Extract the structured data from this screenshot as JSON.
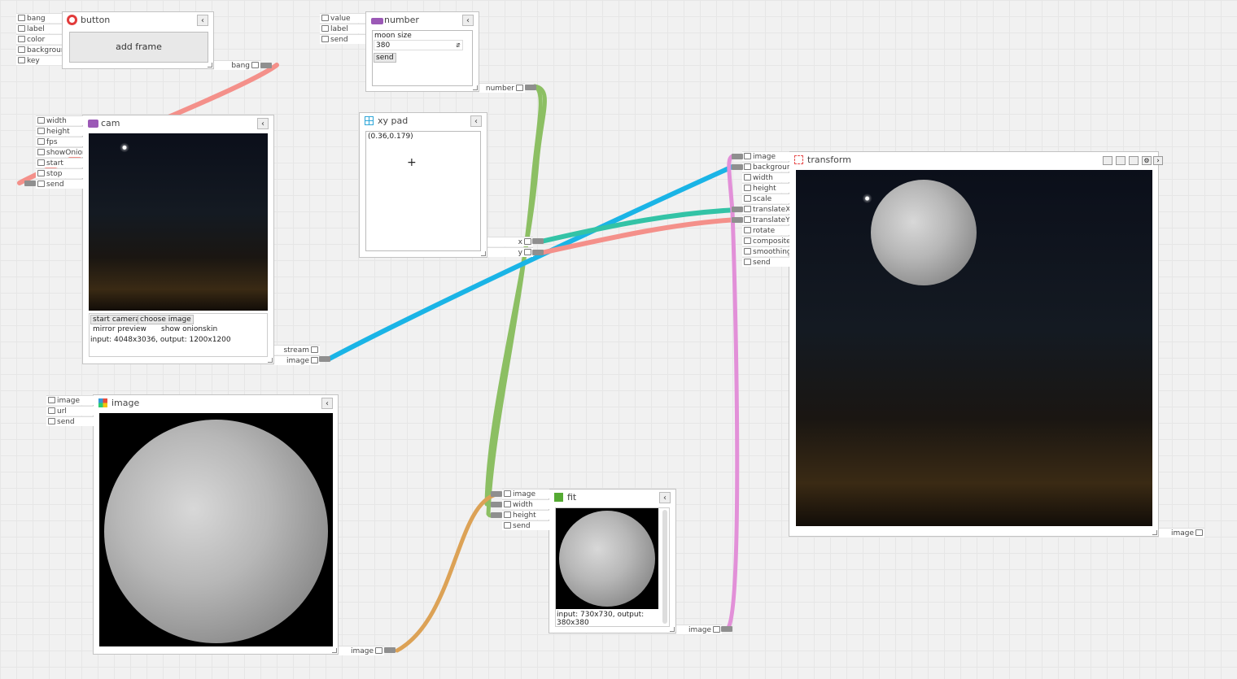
{
  "nodes": {
    "button": {
      "title": "button",
      "inputs": [
        "bang",
        "label",
        "color",
        "background",
        "key"
      ],
      "button_label": "add frame",
      "outputs": [
        "bang"
      ]
    },
    "number": {
      "title": "number",
      "inputs": [
        "value",
        "label",
        "send"
      ],
      "label": "moon size",
      "value": "380",
      "send_label": "send",
      "outputs": [
        "number"
      ]
    },
    "cam": {
      "title": "cam",
      "inputs": [
        "width",
        "height",
        "fps",
        "showOnionskin",
        "start",
        "stop",
        "send"
      ],
      "start_camera": "start camera",
      "choose_image": "choose image",
      "mirror_preview": "mirror preview",
      "show_onionskin": "show onionskin",
      "info": "input: 4048x3036, output: 1200x1200",
      "outputs": [
        "stream",
        "image"
      ]
    },
    "xypad": {
      "title": "xy pad",
      "value": "(0.36,0.179)",
      "outputs": [
        "x",
        "y"
      ]
    },
    "transform": {
      "title": "transform",
      "inputs": [
        "image",
        "background",
        "width",
        "height",
        "scale",
        "translateX",
        "translateY",
        "rotate",
        "composite",
        "smoothing",
        "send"
      ],
      "outputs": [
        "image"
      ]
    },
    "image": {
      "title": "image",
      "inputs": [
        "image",
        "url",
        "send"
      ],
      "outputs": [
        "image"
      ]
    },
    "fit": {
      "title": "fit",
      "inputs": [
        "image",
        "width",
        "height",
        "send"
      ],
      "info": "input: 730x730, output: 380x380",
      "outputs": [
        "image"
      ]
    }
  },
  "colors": {
    "wire_red": "#f4908a",
    "wire_green": "#8cbf63",
    "wire_blue": "#1ab4e6",
    "wire_teal": "#33c3a6",
    "wire_orange": "#dca256",
    "wire_pink": "#e290d8",
    "icon_button": "#e23b3b",
    "icon_number": "#9b59b6",
    "icon_cam": "#9b59b6",
    "icon_xypad": "#2ea6d8",
    "icon_transform": "#e64b4b",
    "icon_fit": "#55aa33"
  },
  "icons": {
    "button": "circle-icon",
    "number": "number-icon",
    "cam": "camera-icon",
    "xypad": "grid-icon",
    "transform": "transform-icon",
    "image": "image-icon",
    "fit": "fit-icon",
    "collapse": "chevron-left-icon"
  }
}
